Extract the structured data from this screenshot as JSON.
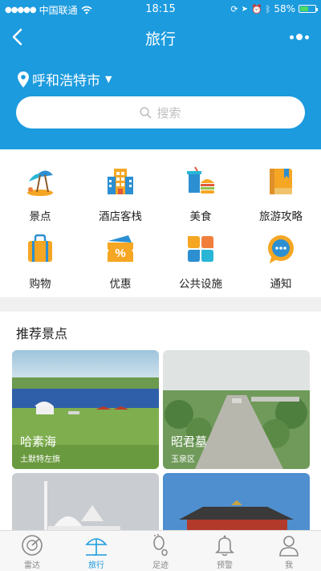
{
  "status": {
    "carrier": "中国联通",
    "time": "18:15",
    "battery": "58%",
    "battery_level": 0.58
  },
  "nav": {
    "title": "旅行"
  },
  "location": {
    "city": "呼和浩特市"
  },
  "search": {
    "placeholder": "搜索"
  },
  "categories": [
    {
      "label": "景点",
      "icon": "beach-umbrella-icon"
    },
    {
      "label": "酒店客栈",
      "icon": "hotel-building-icon"
    },
    {
      "label": "美食",
      "icon": "burger-drink-icon"
    },
    {
      "label": "旅游攻略",
      "icon": "guide-book-icon"
    },
    {
      "label": "购物",
      "icon": "shopping-bag-icon"
    },
    {
      "label": "优惠",
      "icon": "discount-ticket-icon"
    },
    {
      "label": "公共设施",
      "icon": "facilities-grid-icon"
    },
    {
      "label": "通知",
      "icon": "chat-bubble-icon"
    }
  ],
  "recommend": {
    "title": "推荐景点",
    "spots": [
      {
        "name": "哈素海",
        "area": "土默特左旗"
      },
      {
        "name": "昭君墓",
        "area": "玉泉区"
      },
      {
        "name": "",
        "area": ""
      },
      {
        "name": "",
        "area": ""
      }
    ]
  },
  "tabbar": {
    "active_color": "#1c9bde",
    "items": [
      {
        "label": "雷达",
        "icon": "radar-icon"
      },
      {
        "label": "旅行",
        "icon": "travel-umbrella-icon"
      },
      {
        "label": "足迹",
        "icon": "footprint-icon"
      },
      {
        "label": "预警",
        "icon": "bell-icon"
      },
      {
        "label": "我",
        "icon": "person-icon"
      }
    ]
  }
}
